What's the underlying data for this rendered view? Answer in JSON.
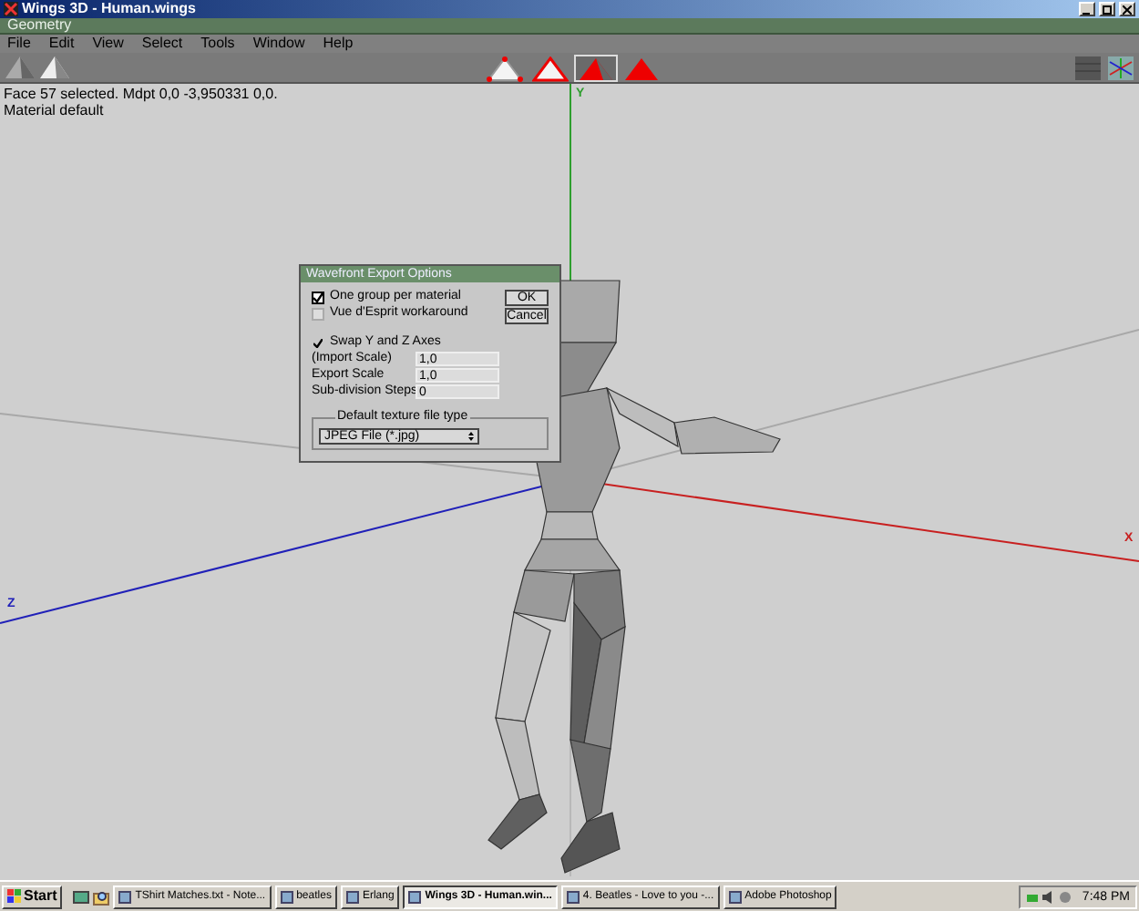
{
  "window": {
    "title": "Wings 3D - Human.wings"
  },
  "geometry_bar": {
    "title": "Geometry"
  },
  "menu": [
    "File",
    "Edit",
    "View",
    "Select",
    "Tools",
    "Window",
    "Help"
  ],
  "selection_modes": [
    {
      "kind": "vertex",
      "selected": false
    },
    {
      "kind": "edge",
      "selected": false
    },
    {
      "kind": "face",
      "selected": true
    },
    {
      "kind": "body",
      "selected": false
    }
  ],
  "status": [
    "Face 57 selected. Mdpt 0,0 -3,950331 0,0.",
    "Material default"
  ],
  "axes": [
    {
      "label": "Y",
      "color": "#2e9e2e"
    },
    {
      "label": "X",
      "color": "#c82020"
    },
    {
      "label": "Z",
      "color": "#2020b8"
    }
  ],
  "dialog": {
    "title": "Wavefront Export Options",
    "checkboxes": [
      {
        "label": "One group per material",
        "checked": true
      },
      {
        "label": "Vue d'Esprit workaround",
        "checked": false
      }
    ],
    "buttons": [
      "OK",
      "Cancel"
    ],
    "swap": {
      "label": "Swap Y and Z Axes",
      "checked": true
    },
    "fields": [
      {
        "label": "(Import Scale)",
        "value": "1,0"
      },
      {
        "label": "Export Scale",
        "value": "1,0"
      },
      {
        "label": "Sub-division Steps",
        "value": "0"
      }
    ],
    "texture_group": {
      "title": "Default texture file type",
      "value": "JPEG File (*.jpg)"
    }
  },
  "taskbar": {
    "start": "Start",
    "tasks": [
      {
        "label": "TShirt Matches.txt - Note...",
        "selected": false
      },
      {
        "label": "beatles",
        "selected": false
      },
      {
        "label": "Erlang",
        "selected": false
      },
      {
        "label": "Wings 3D - Human.win...",
        "selected": true
      },
      {
        "label": "4. Beatles - Love to you -...",
        "selected": false
      },
      {
        "label": "Adobe Photoshop",
        "selected": false
      }
    ],
    "clock": "7:48 PM"
  }
}
